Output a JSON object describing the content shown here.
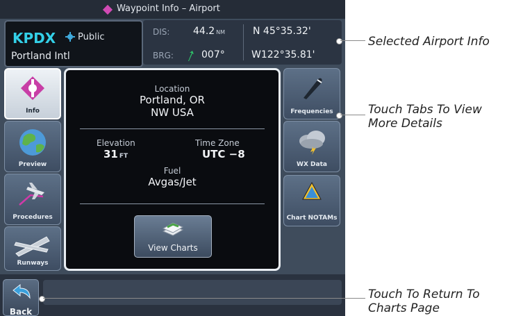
{
  "title_bar": {
    "title": "Waypoint Info – Airport"
  },
  "identifier": {
    "code": "KPDX",
    "type": "Public",
    "name": "Portland Intl"
  },
  "position": {
    "dis_label": "DIS:",
    "dis_value": "44.2",
    "dis_unit": "NM",
    "brg_label": "BRG:",
    "brg_value": "007°",
    "lat": "N 45°35.32'",
    "lon": "W122°35.81'"
  },
  "tabs_left": [
    {
      "label": "Info",
      "icon": "airport-icon",
      "active": true
    },
    {
      "label": "Preview",
      "icon": "globe-icon"
    },
    {
      "label": "Procedures",
      "icon": "procedures-icon"
    },
    {
      "label": "Runways",
      "icon": "runway-icon"
    }
  ],
  "tabs_right": [
    {
      "label": "Frequencies",
      "icon": "headset-icon"
    },
    {
      "label": "WX Data",
      "icon": "cloud-icon"
    },
    {
      "label": "Chart NOTAMs",
      "icon": "notam-icon"
    }
  ],
  "details": {
    "location_label": "Location",
    "location_city": "Portland, OR",
    "location_region": "NW USA",
    "elevation_label": "Elevation",
    "elevation_value": "31",
    "elevation_unit": "FT",
    "timezone_label": "Time Zone",
    "timezone_value": "UTC −8",
    "fuel_label": "Fuel",
    "fuel_value": "Avgas/Jet"
  },
  "view_charts": {
    "label": "View Charts"
  },
  "back": {
    "label": "Back"
  },
  "callouts": {
    "selected_airport": "Selected Airport Info",
    "tabs_line1": "Touch Tabs To View",
    "tabs_line2": "More Details",
    "return_line1": "Touch To Return To",
    "return_line2": "Charts Page"
  },
  "colors": {
    "accent_cyan": "#33d0e8",
    "waypoint_magenta": "#d14ab4",
    "panel_bg": "#0a0c10"
  }
}
